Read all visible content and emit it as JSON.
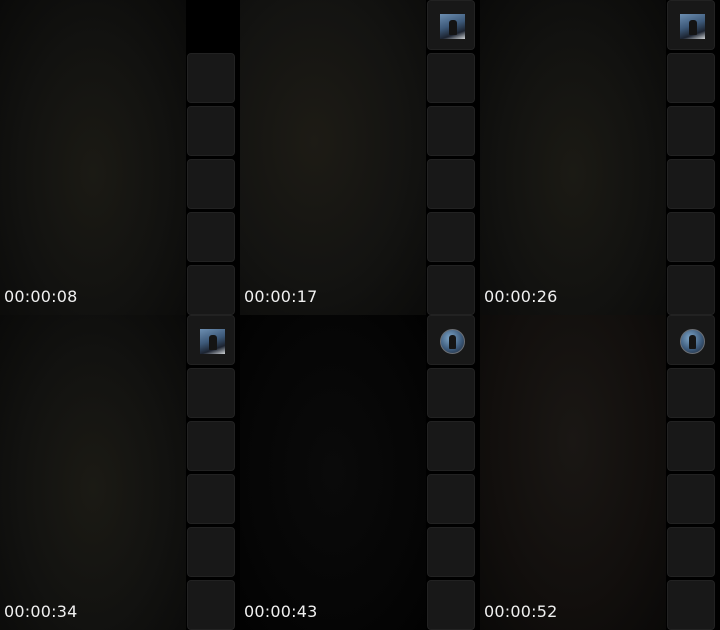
{
  "frames": [
    {
      "timestamp": "00:00:08",
      "participant_avatar": "none"
    },
    {
      "timestamp": "00:00:17",
      "participant_avatar": "square-photo"
    },
    {
      "timestamp": "00:00:26",
      "participant_avatar": "square-photo"
    },
    {
      "timestamp": "00:00:34",
      "participant_avatar": "square-photo"
    },
    {
      "timestamp": "00:00:43",
      "participant_avatar": "round-photo"
    },
    {
      "timestamp": "00:00:52",
      "participant_avatar": "round-photo"
    }
  ],
  "colors": {
    "background": "#000000",
    "tile": "#181818",
    "timestamp_text": "#f0f0f0"
  }
}
